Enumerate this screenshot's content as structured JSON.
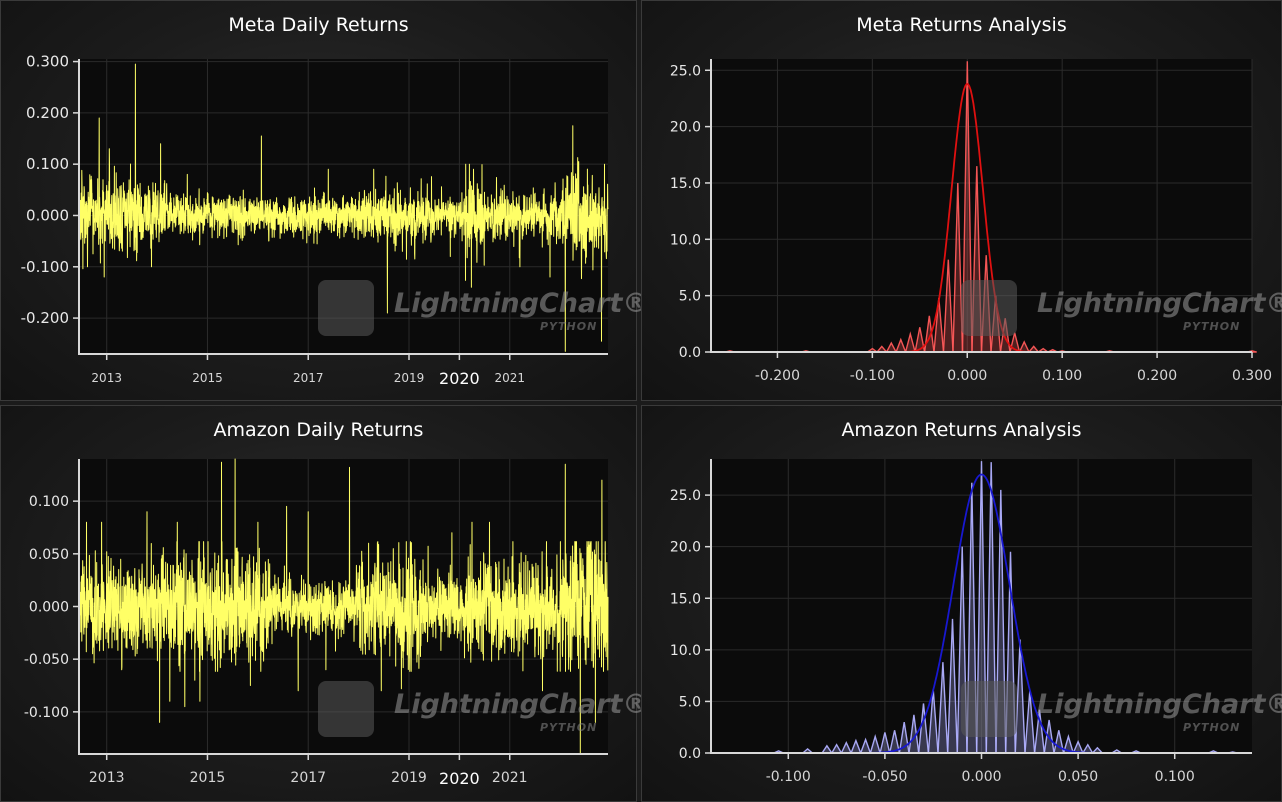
{
  "watermark": {
    "brand": "LightningChart®",
    "sub": "PYTHON"
  },
  "chart_data": [
    {
      "id": "meta-daily",
      "type": "line",
      "title": "Meta Daily Returns",
      "color": "#ffff66",
      "xlim": [
        2012.45,
        2022.95
      ],
      "ylim": [
        -0.27,
        0.305
      ],
      "x_ticks": [
        "2013",
        "2015",
        "2017",
        "2019",
        "2020",
        "2021"
      ],
      "y_ticks": [
        "0.300",
        "0.200",
        "0.100",
        "0.000",
        "-0.100",
        "-0.200"
      ],
      "series": [
        {
          "noise_sd": 0.022,
          "volatility_regimes": [
            [
              2012.45,
              2014.2,
              1.7
            ],
            [
              2014.2,
              2018.0,
              0.85
            ],
            [
              2018.0,
              2019.5,
              1.2
            ],
            [
              2019.5,
              2020.1,
              0.9
            ],
            [
              2020.1,
              2020.5,
              1.9
            ],
            [
              2020.5,
              2022.0,
              1.0
            ],
            [
              2022.0,
              2022.95,
              1.8
            ]
          ],
          "spikes": [
            [
              2012.62,
              -0.1
            ],
            [
              2012.7,
              0.07
            ],
            [
              2012.85,
              0.19
            ],
            [
              2012.95,
              -0.12
            ],
            [
              2013.05,
              0.13
            ],
            [
              2013.57,
              0.295
            ],
            [
              2014.07,
              0.14
            ],
            [
              2014.6,
              0.08
            ],
            [
              2016.07,
              0.155
            ],
            [
              2017.4,
              0.09
            ],
            [
              2018.3,
              0.09
            ],
            [
              2018.57,
              -0.19
            ],
            [
              2018.87,
              -0.07
            ],
            [
              2019.82,
              -0.08
            ],
            [
              2020.2,
              0.1
            ],
            [
              2020.24,
              -0.14
            ],
            [
              2020.28,
              0.09
            ],
            [
              2021.2,
              -0.1
            ],
            [
              2021.8,
              -0.12
            ],
            [
              2022.1,
              -0.265
            ],
            [
              2022.25,
              0.175
            ],
            [
              2022.82,
              -0.245
            ],
            [
              2022.88,
              0.1
            ]
          ]
        }
      ]
    },
    {
      "id": "meta-analysis",
      "type": "area",
      "title": "Meta Returns Analysis",
      "color": "#ff5a5a",
      "curve_color": "#e01010",
      "xlim": [
        -0.27,
        0.3
      ],
      "ylim": [
        0,
        26.0
      ],
      "x_ticks": [
        "-0.200",
        "-0.100",
        "0.000",
        "0.100",
        "0.200",
        "0.300"
      ],
      "y_ticks": [
        "25.0",
        "20.0",
        "15.0",
        "10.0",
        "5.0",
        "0.0"
      ],
      "series": [
        {
          "bin_width": 0.01,
          "bins": [
            [
              -0.25,
              0.1
            ],
            [
              -0.17,
              0.1
            ],
            [
              -0.1,
              0.3
            ],
            [
              -0.09,
              0.5
            ],
            [
              -0.08,
              0.8
            ],
            [
              -0.07,
              1.1
            ],
            [
              -0.06,
              1.6
            ],
            [
              -0.05,
              2.2
            ],
            [
              -0.04,
              3.2
            ],
            [
              -0.03,
              4.8
            ],
            [
              -0.02,
              8.2
            ],
            [
              -0.01,
              15.0
            ],
            [
              0.0,
              25.8
            ],
            [
              0.01,
              16.5
            ],
            [
              0.02,
              8.6
            ],
            [
              0.03,
              5.0
            ],
            [
              0.04,
              3.0
            ],
            [
              0.05,
              1.7
            ],
            [
              0.06,
              0.9
            ],
            [
              0.07,
              0.5
            ],
            [
              0.08,
              0.3
            ],
            [
              0.09,
              0.2
            ],
            [
              0.1,
              0.1
            ],
            [
              0.15,
              0.1
            ],
            [
              0.3,
              0.1
            ]
          ],
          "curve": {
            "peak": 23.8,
            "center": 0.0,
            "sd": 0.0165
          }
        }
      ]
    },
    {
      "id": "amazon-daily",
      "type": "line",
      "title": "Amazon Daily Returns",
      "color": "#ffff66",
      "xlim": [
        2012.45,
        2022.95
      ],
      "ylim": [
        -0.14,
        0.14
      ],
      "x_ticks": [
        "2013",
        "2015",
        "2017",
        "2019",
        "2020",
        "2021"
      ],
      "y_ticks": [
        "0.100",
        "0.050",
        "0.000",
        "-0.050",
        "-0.100"
      ],
      "series": [
        {
          "noise_sd": 0.0185,
          "volatility_regimes": [
            [
              2012.45,
              2014.0,
              1.2
            ],
            [
              2014.0,
              2016.3,
              1.3
            ],
            [
              2016.3,
              2018.0,
              0.75
            ],
            [
              2018.0,
              2019.4,
              1.35
            ],
            [
              2019.4,
              2020.1,
              0.75
            ],
            [
              2020.1,
              2022.0,
              1.25
            ],
            [
              2022.0,
              2022.95,
              1.75
            ]
          ],
          "spikes": [
            [
              2012.6,
              0.08
            ],
            [
              2012.9,
              0.08
            ],
            [
              2013.3,
              -0.06
            ],
            [
              2013.8,
              0.09
            ],
            [
              2014.05,
              -0.11
            ],
            [
              2014.25,
              -0.09
            ],
            [
              2014.4,
              0.08
            ],
            [
              2014.55,
              -0.095
            ],
            [
              2014.75,
              -0.07
            ],
            [
              2014.85,
              -0.09
            ],
            [
              2015.28,
              0.137
            ],
            [
              2015.55,
              0.14
            ],
            [
              2015.85,
              -0.075
            ],
            [
              2016.0,
              0.08
            ],
            [
              2016.57,
              0.095
            ],
            [
              2016.8,
              -0.08
            ],
            [
              2017.0,
              0.09
            ],
            [
              2017.35,
              -0.06
            ],
            [
              2017.82,
              0.132
            ],
            [
              2018.2,
              0.06
            ],
            [
              2018.45,
              -0.08
            ],
            [
              2018.85,
              -0.078
            ],
            [
              2019.85,
              0.07
            ],
            [
              2020.25,
              0.08
            ],
            [
              2020.6,
              0.08
            ],
            [
              2021.65,
              -0.08
            ],
            [
              2022.1,
              0.135
            ],
            [
              2022.4,
              -0.14
            ],
            [
              2022.7,
              -0.11
            ],
            [
              2022.83,
              0.12
            ]
          ]
        }
      ]
    },
    {
      "id": "amazon-analysis",
      "type": "area",
      "title": "Amazon Returns Analysis",
      "color": "#b0b0ff",
      "curve_color": "#1818d0",
      "xlim": [
        -0.14,
        0.14
      ],
      "ylim": [
        0,
        28.5
      ],
      "x_ticks": [
        "-0.100",
        "-0.050",
        "0.000",
        "0.050",
        "0.100"
      ],
      "y_ticks": [
        "25.0",
        "20.0",
        "15.0",
        "10.0",
        "5.0",
        "0.0"
      ],
      "series": [
        {
          "bin_width": 0.005,
          "bins": [
            [
              -0.105,
              0.2
            ],
            [
              -0.09,
              0.4
            ],
            [
              -0.08,
              0.7
            ],
            [
              -0.075,
              0.8
            ],
            [
              -0.07,
              1.0
            ],
            [
              -0.065,
              1.2
            ],
            [
              -0.06,
              1.3
            ],
            [
              -0.055,
              1.6
            ],
            [
              -0.05,
              2.0
            ],
            [
              -0.045,
              2.2
            ],
            [
              -0.04,
              3.0
            ],
            [
              -0.035,
              3.7
            ],
            [
              -0.03,
              4.8
            ],
            [
              -0.025,
              6.2
            ],
            [
              -0.02,
              8.8
            ],
            [
              -0.015,
              13.0
            ],
            [
              -0.01,
              20.0
            ],
            [
              -0.005,
              26.2
            ],
            [
              0.0,
              28.3
            ],
            [
              0.005,
              28.2
            ],
            [
              0.01,
              25.5
            ],
            [
              0.015,
              19.5
            ],
            [
              0.02,
              11.0
            ],
            [
              0.025,
              6.0
            ],
            [
              0.03,
              4.2
            ],
            [
              0.035,
              3.2
            ],
            [
              0.04,
              2.2
            ],
            [
              0.045,
              1.6
            ],
            [
              0.05,
              1.1
            ],
            [
              0.055,
              0.8
            ],
            [
              0.06,
              0.5
            ],
            [
              0.07,
              0.3
            ],
            [
              0.08,
              0.2
            ],
            [
              0.12,
              0.2
            ],
            [
              0.13,
              0.1
            ]
          ],
          "curve": {
            "peak": 27.0,
            "center": 0.0,
            "sd": 0.0145
          }
        }
      ]
    }
  ]
}
